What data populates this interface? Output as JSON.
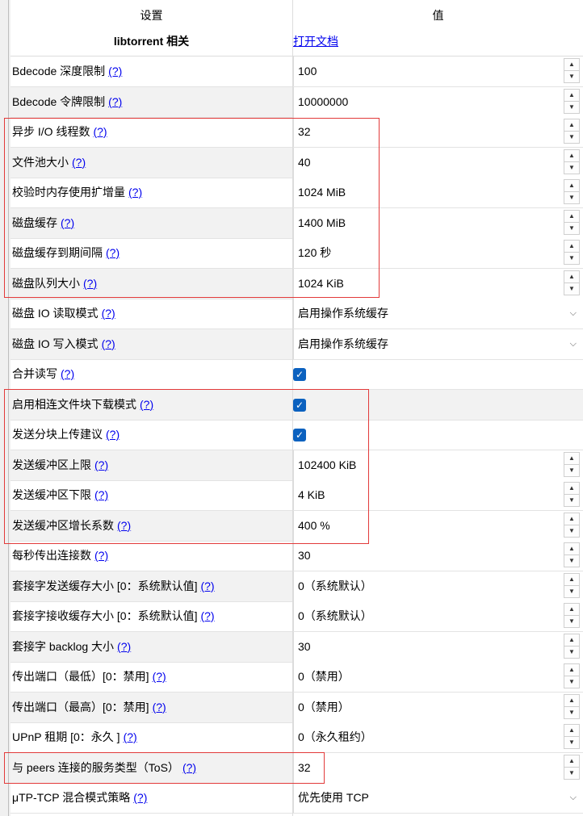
{
  "header": {
    "col_setting": "设置",
    "col_value": "值",
    "section_title": "libtorrent 相关",
    "open_docs": "打开文档"
  },
  "help_text": "(?)",
  "colors": {
    "link": "#0000ee",
    "highlight_box": "#e23a3a",
    "checkbox": "#0b61bf"
  },
  "rows": [
    {
      "label": "Bdecode 深度限制",
      "type": "spin",
      "value": "100"
    },
    {
      "label": "Bdecode 令牌限制",
      "type": "spin",
      "value": "10000000"
    },
    {
      "label": "异步 I/O 线程数",
      "type": "spin",
      "value": "32"
    },
    {
      "label": "文件池大小",
      "type": "spin",
      "value": "40"
    },
    {
      "label": "校验时内存使用扩增量",
      "type": "spin",
      "value": "1024 MiB"
    },
    {
      "label": "磁盘缓存",
      "type": "spin",
      "value": "1400 MiB"
    },
    {
      "label": "磁盘缓存到期间隔",
      "type": "spin",
      "value": "120 秒"
    },
    {
      "label": "磁盘队列大小",
      "type": "spin",
      "value": "1024 KiB"
    },
    {
      "label": "磁盘 IO 读取模式",
      "type": "select",
      "value": "启用操作系统缓存"
    },
    {
      "label": "磁盘 IO 写入模式",
      "type": "select",
      "value": "启用操作系统缓存"
    },
    {
      "label": "合并读写",
      "type": "checkbox",
      "checked": true
    },
    {
      "label": "启用相连文件块下载模式",
      "type": "checkbox",
      "checked": true
    },
    {
      "label": "发送分块上传建议",
      "type": "checkbox",
      "checked": true
    },
    {
      "label": "发送缓冲区上限",
      "type": "spin",
      "value": "102400 KiB"
    },
    {
      "label": "发送缓冲区下限",
      "type": "spin",
      "value": "4 KiB"
    },
    {
      "label": "发送缓冲区增长系数",
      "type": "spin",
      "value": "400 %"
    },
    {
      "label": "每秒传出连接数",
      "type": "spin",
      "value": "30"
    },
    {
      "label": "套接字发送缓存大小 [0：系统默认值]",
      "type": "spin",
      "value": "0（系统默认）"
    },
    {
      "label": "套接字接收缓存大小 [0：系统默认值]",
      "type": "spin",
      "value": "0（系统默认）"
    },
    {
      "label": "套接字 backlog 大小",
      "type": "spin",
      "value": "30"
    },
    {
      "label": "传出端口（最低）[0：禁用]",
      "type": "spin",
      "value": "0（禁用）"
    },
    {
      "label": "传出端口（最高）[0：禁用]",
      "type": "spin",
      "value": "0（禁用）"
    },
    {
      "label": "UPnP 租期 [0：永久 ]",
      "type": "spin",
      "value": "0（永久租约）"
    },
    {
      "label": "与 peers 连接的服务类型（ToS）",
      "type": "spin",
      "value": "32"
    },
    {
      "label": "μTP-TCP 混合模式策略",
      "type": "select",
      "value": "优先使用 TCP"
    }
  ]
}
